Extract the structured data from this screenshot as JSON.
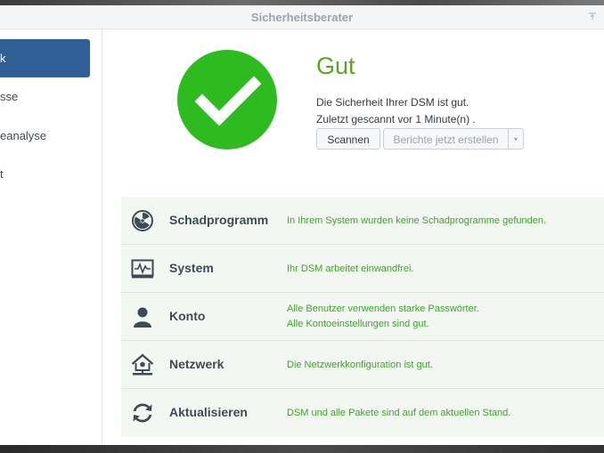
{
  "window": {
    "title": "Sicherheitsberater"
  },
  "sidebar": {
    "items": [
      {
        "label": "k",
        "active": true
      },
      {
        "label": "sse",
        "active": false
      },
      {
        "label": "eanalyse",
        "active": false
      },
      {
        "label": "t",
        "active": false
      }
    ]
  },
  "status": {
    "title": "Gut",
    "line1": "Die Sicherheit Ihrer DSM ist gut.",
    "line2": "Zuletzt gescannt vor 1 Minute(n) .",
    "scan_label": "Scannen",
    "report_label": "Berichte jetzt erstellen",
    "dropdown_glyph": "▾",
    "color": "#2dbb1f"
  },
  "categories": [
    {
      "icon": "radiation-icon",
      "label": "Schadprogramm",
      "messages": [
        "In Ihrem System wurden keine Schadprogramme gefunden."
      ]
    },
    {
      "icon": "system-monitor-icon",
      "label": "System",
      "messages": [
        "Ihr DSM arbeitet einwandfrei."
      ]
    },
    {
      "icon": "user-icon",
      "label": "Konto",
      "messages": [
        "Alle Benutzer verwenden starke Passwörter.",
        "Alle Kontoeinstellungen sind gut."
      ]
    },
    {
      "icon": "network-home-icon",
      "label": "Netzwerk",
      "messages": [
        "Die Netzwerkkonfiguration ist gut."
      ]
    },
    {
      "icon": "refresh-icon",
      "label": "Aktualisieren",
      "messages": [
        "DSM und alle Pakete sind auf dem aktuellen Stand."
      ]
    }
  ],
  "colors": {
    "accent": "#2f5f95",
    "ok_green": "#3ea32b",
    "title_green": "#5aa520"
  }
}
